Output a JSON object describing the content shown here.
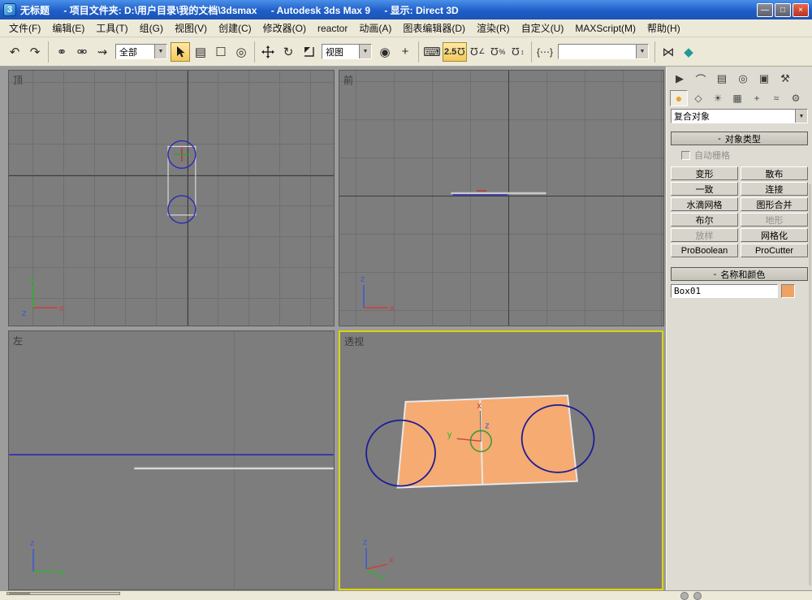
{
  "titlebar": {
    "title_doc": "无标题",
    "title_project": "- 项目文件夹: D:\\用户目录\\我的文档\\3dsmax",
    "title_app": "- Autodesk 3ds Max 9",
    "title_display": "- 显示: Direct 3D"
  },
  "menubar": {
    "items": [
      "文件(F)",
      "编辑(E)",
      "工具(T)",
      "组(G)",
      "视图(V)",
      "创建(C)",
      "修改器(O)",
      "reactor",
      "动画(A)",
      "图表编辑器(D)",
      "渲染(R)",
      "自定义(U)",
      "MAXScript(M)",
      "帮助(H)"
    ]
  },
  "toolbar": {
    "selection_filter_value": "全部",
    "coordinate_system_value": "视图",
    "snap_label": "2.5",
    "named_selection_value": ""
  },
  "icons": {
    "logo": "3",
    "win_min": "—",
    "win_max": "□",
    "win_close": "×",
    "undo": "↶",
    "redo": "↷",
    "select_link": "⚭",
    "unlink": "⚮",
    "bind_spacewarp": "⇝",
    "select_by_name": "▤",
    "rect_region": "☐",
    "crossing_region": "◎",
    "rotate": "↻",
    "pivot": "◉",
    "manipulate": "+",
    "keyboard": "⌨",
    "magnet": "Ω",
    "angle": "∠",
    "percent": "%",
    "spinner": "↕",
    "sel_sets": "{⋯}",
    "mirror": "⋈",
    "align": "◆",
    "dd_arrow": "▼",
    "tab_create": "▶",
    "tab_modify": "⌒",
    "tab_hierarchy": "▤",
    "tab_motion": "◎",
    "tab_display": "▣",
    "tab_utilities": "⚒",
    "cat_geometry": "●",
    "cat_shapes": "◇",
    "cat_lights": "☀",
    "cat_cameras": "▦",
    "cat_helpers": "+",
    "cat_spacewarps": "≈",
    "cat_systems": "⚙",
    "rollout_minus": "-"
  },
  "viewports": {
    "top_label": "顶",
    "front_label": "前",
    "left_label": "左",
    "persp_label": "透视"
  },
  "axis": {
    "x": "x",
    "y": "y",
    "z": "z"
  },
  "command_panel": {
    "category_value": "复合对象",
    "object_type_title": "对象类型",
    "autogrid_label": "自动栅格",
    "buttons": [
      {
        "label": "变形",
        "enabled": true
      },
      {
        "label": "散布",
        "enabled": true
      },
      {
        "label": "一致",
        "enabled": true
      },
      {
        "label": "连接",
        "enabled": true
      },
      {
        "label": "水滴网格",
        "enabled": true
      },
      {
        "label": "图形合并",
        "enabled": true
      },
      {
        "label": "布尔",
        "enabled": true
      },
      {
        "label": "地形",
        "enabled": false
      },
      {
        "label": "放样",
        "enabled": false
      },
      {
        "label": "网格化",
        "enabled": true
      },
      {
        "label": "ProBoolean",
        "enabled": true
      },
      {
        "label": "ProCutter",
        "enabled": true
      }
    ],
    "name_color_title": "名称和颜色",
    "object_name": "Box01",
    "object_color": "#f0a263"
  },
  "colors": {
    "active_tool_bg": "#f6d97e",
    "active_viewport_border": "#ddd400",
    "object_fill": "#f5ab72",
    "spline_blue": "#2a2ab8",
    "circle_navy": "#1c1c96",
    "center_circle_green": "#3b9a3b"
  }
}
